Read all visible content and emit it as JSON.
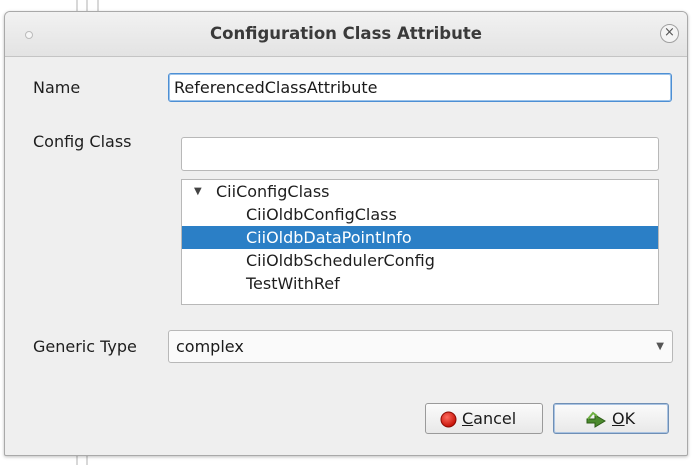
{
  "dialog": {
    "title": "Configuration Class Attribute",
    "close_label": "×"
  },
  "form": {
    "name_label": "Name",
    "name_value": "ReferencedClassAttribute",
    "config_class_label": "Config Class",
    "filter_value": "",
    "tree": {
      "parent": "CiiConfigClass",
      "children": [
        "CiiOldbConfigClass",
        "CiiOldbDataPointInfo",
        "CiiOldbSchedulerConfig",
        "TestWithRef"
      ],
      "selected": "CiiOldbDataPointInfo"
    },
    "generic_type_label": "Generic Type",
    "generic_type_value": "complex"
  },
  "buttons": {
    "cancel_mnemonic": "C",
    "cancel_rest": "ancel",
    "ok_mnemonic": "O",
    "ok_rest": "K"
  },
  "colors": {
    "selection": "#2b7fc6",
    "focus_border": "#4d8fd4",
    "dialog_bg": "#efefef"
  },
  "icons": {
    "cancel": "red-stop-circle-icon",
    "ok": "green-check-arrow-icon",
    "close": "close-icon"
  }
}
